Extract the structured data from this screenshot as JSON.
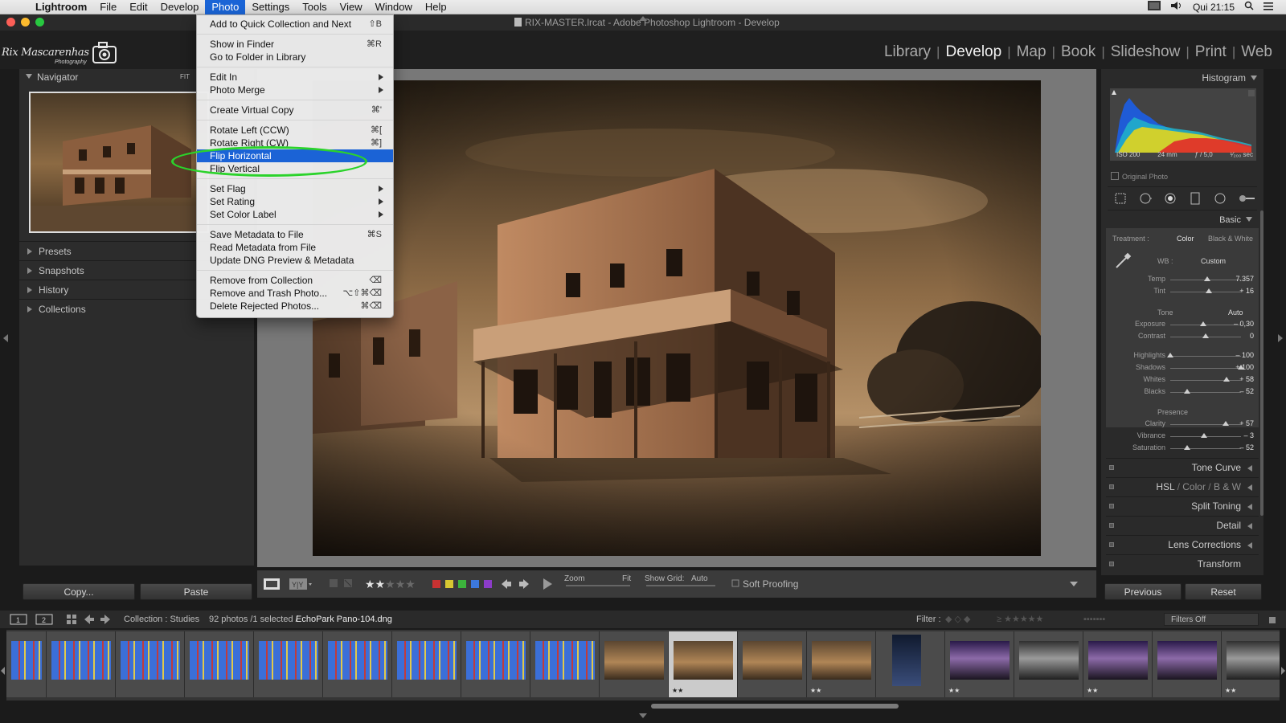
{
  "menubar": {
    "app": "Lightroom",
    "menus": [
      "File",
      "Edit",
      "Develop",
      "Photo",
      "Settings",
      "Tools",
      "View",
      "Window",
      "Help"
    ],
    "active_menu": "Photo",
    "clock": "Qui 21:15"
  },
  "window": {
    "title": "RIX-MASTER.lrcat - Adobe Photoshop Lightroom - Develop"
  },
  "identity_plate": {
    "name": "Rix Mascarenhas",
    "sub": "Photography"
  },
  "modules": [
    "Library",
    "Develop",
    "Map",
    "Book",
    "Slideshow",
    "Print",
    "Web"
  ],
  "active_module": "Develop",
  "left_panel": {
    "navigator": {
      "title": "Navigator",
      "zoom": "FIT"
    },
    "sections": [
      "Presets",
      "Snapshots",
      "History",
      "Collections"
    ],
    "copy_label": "Copy...",
    "paste_label": "Paste"
  },
  "photo_menu": {
    "items": [
      {
        "label": "Add to Quick Collection and Next",
        "shortcut": "⇧B"
      },
      {
        "sep": true
      },
      {
        "label": "Show in Finder",
        "shortcut": "⌘R"
      },
      {
        "label": "Go to Folder in Library",
        "shortcut": ""
      },
      {
        "sep": true
      },
      {
        "label": "Edit In",
        "submenu": true
      },
      {
        "label": "Photo Merge",
        "submenu": true
      },
      {
        "sep": true
      },
      {
        "label": "Create Virtual Copy",
        "shortcut": "⌘'"
      },
      {
        "sep": true
      },
      {
        "label": "Rotate Left (CCW)",
        "shortcut": "⌘["
      },
      {
        "label": "Rotate Right (CW)",
        "shortcut": "⌘]"
      },
      {
        "label": "Flip Horizontal",
        "highlighted": true
      },
      {
        "label": "Flip Vertical",
        "shortcut": ""
      },
      {
        "sep": true
      },
      {
        "label": "Set Flag",
        "submenu": true
      },
      {
        "label": "Set Rating",
        "submenu": true
      },
      {
        "label": "Set Color Label",
        "submenu": true
      },
      {
        "sep": true
      },
      {
        "label": "Save Metadata to File",
        "shortcut": "⌘S"
      },
      {
        "label": "Read Metadata from File",
        "shortcut": ""
      },
      {
        "label": "Update DNG Preview & Metadata",
        "shortcut": ""
      },
      {
        "sep": true
      },
      {
        "label": "Remove from Collection",
        "shortcut": "⌫"
      },
      {
        "label": "Remove and Trash Photo...",
        "shortcut": "⌥⇧⌘⌫"
      },
      {
        "label": "Delete Rejected Photos...",
        "shortcut": "⌘⌫"
      }
    ]
  },
  "right_panel": {
    "histogram_title": "Histogram",
    "exif": [
      "ISO 200",
      "24 mm",
      "ƒ / 5,0",
      "¹⁄₂₀₀ sec"
    ],
    "original_photo": "Original Photo",
    "basic_title": "Basic",
    "treatment_label": "Treatment :",
    "treatment_options": [
      "Color",
      "Black & White"
    ],
    "wb_label": "WB :",
    "wb_value": "Custom",
    "tone_label": "Tone",
    "auto_label": "Auto",
    "presence_label": "Presence",
    "sliders": [
      {
        "label": "Temp",
        "value": "7.357",
        "level": 0.52
      },
      {
        "label": "Tint",
        "value": "+ 16",
        "level": 0.54
      },
      {
        "label": "Exposure",
        "value": "– 0,30",
        "level": 0.47
      },
      {
        "label": "Contrast",
        "value": "0",
        "level": 0.5
      },
      {
        "label": "Highlights",
        "value": "– 100",
        "level": 0.0
      },
      {
        "label": "Shadows",
        "value": "+ 100",
        "level": 1.0
      },
      {
        "label": "Whites",
        "value": "+ 58",
        "level": 0.79
      },
      {
        "label": "Blacks",
        "value": "– 52",
        "level": 0.24
      },
      {
        "label": "Clarity",
        "value": "+ 57",
        "level": 0.78
      },
      {
        "label": "Vibrance",
        "value": "– 3",
        "level": 0.48
      },
      {
        "label": "Saturation",
        "value": "– 52",
        "level": 0.24
      }
    ],
    "panels": [
      "Tone Curve",
      "Split Toning",
      "Detail",
      "Lens Corrections",
      "Transform"
    ],
    "hsl": [
      "HSL",
      "Color",
      "B & W"
    ],
    "previous_label": "Previous",
    "reset_label": "Reset"
  },
  "toolbar": {
    "zoom_label": "Zoom",
    "zoom_value": "Fit",
    "grid_label": "Show Grid:",
    "grid_value": "Auto",
    "soft_proofing": "Soft Proofing",
    "rating": 2,
    "labels": [
      "#c83232",
      "#d7c832",
      "#3cb43c",
      "#3c78dc",
      "#8c3cc8"
    ]
  },
  "filmstrip": {
    "collection": "Collection : Studies",
    "count": "92 photos /1 selected /",
    "filename": "EchoPark Pano-104.dng",
    "filter_label": "Filter :",
    "filters_off": "Filters Off",
    "page1": "1",
    "page2": "2"
  }
}
